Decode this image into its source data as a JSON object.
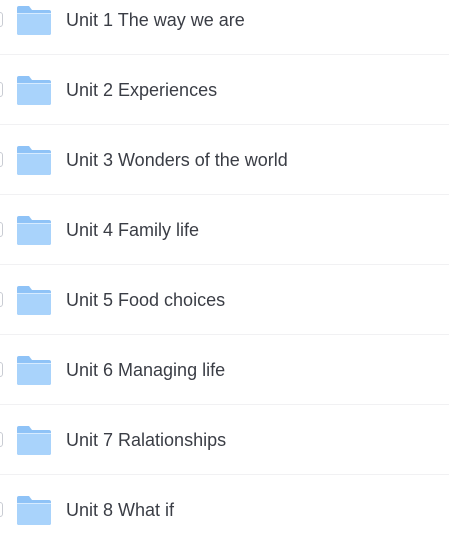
{
  "folders": [
    {
      "name": "Unit 1 The way we are",
      "icon": "folder-icon"
    },
    {
      "name": "Unit 2 Experiences",
      "icon": "folder-icon"
    },
    {
      "name": "Unit 3 Wonders of the world",
      "icon": "folder-icon"
    },
    {
      "name": "Unit 4 Family life",
      "icon": "folder-icon"
    },
    {
      "name": "Unit 5 Food choices",
      "icon": "folder-icon"
    },
    {
      "name": "Unit 6 Managing life",
      "icon": "folder-icon"
    },
    {
      "name": "Unit 7 Ralationships",
      "icon": "folder-icon"
    },
    {
      "name": "Unit 8 What if",
      "icon": "folder-icon"
    }
  ],
  "colors": {
    "folder_back": "#8fc3f7",
    "folder_front": "#a9d3fb",
    "text": "#3a3d45",
    "divider": "#f1f1f3"
  }
}
